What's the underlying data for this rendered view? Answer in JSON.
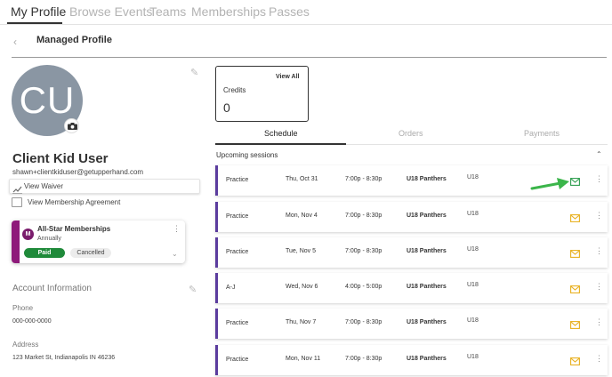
{
  "top_tabs": {
    "items": [
      {
        "label": "My Profile"
      },
      {
        "label": "Browse Events"
      },
      {
        "label": "Teams"
      },
      {
        "label": "Memberships"
      },
      {
        "label": "Passes"
      }
    ],
    "active": "My Profile"
  },
  "header": {
    "title": "Managed Profile",
    "back_icon": "chevron-left-icon"
  },
  "profile": {
    "avatar_initials": "CU",
    "name": "Client Kid User",
    "email": "shawn+clientkiduser@getupperhand.com",
    "waiver_label": "View Waiver",
    "agreement_label": "View Membership Agreement"
  },
  "membership": {
    "logo_text": "M",
    "title": "All-Star Memberships",
    "frequency": "Annually",
    "status_paid": "Paid",
    "status_cancelled": "Cancelled",
    "accent_color": "#8e1a7a"
  },
  "account": {
    "title": "Account Information",
    "phone_label": "Phone",
    "phone_value": "000-000-0000",
    "address_label": "Address",
    "address_value": "123 Market St, Indianapolis IN 46236"
  },
  "credits": {
    "label": "Credits",
    "value": "0",
    "view_all": "View All"
  },
  "schedule_tabs": {
    "items": [
      {
        "label": "Schedule"
      },
      {
        "label": "Orders"
      },
      {
        "label": "Payments"
      }
    ],
    "active": "Schedule"
  },
  "upcoming": {
    "label": "Upcoming sessions"
  },
  "sessions": [
    {
      "type": "Practice",
      "date": "Thu, Oct 31",
      "time": "7:00p  -  8:30p",
      "team": "U18 Panthers",
      "age": "U18",
      "mail_status": "sent",
      "mail_color": "#2e9e4f"
    },
    {
      "type": "Practice",
      "date": "Mon, Nov 4",
      "time": "7:00p  -  8:30p",
      "team": "U18 Panthers",
      "age": "U18",
      "mail_status": "pending",
      "mail_color": "#e8b020"
    },
    {
      "type": "Practice",
      "date": "Tue, Nov 5",
      "time": "7:00p  -  8:30p",
      "team": "U18 Panthers",
      "age": "U18",
      "mail_status": "pending",
      "mail_color": "#e8b020"
    },
    {
      "type": "A-J",
      "date": "Wed, Nov 6",
      "time": "4:00p  -  5:00p",
      "team": "U18 Panthers",
      "age": "U18",
      "mail_status": "pending",
      "mail_color": "#e8b020"
    },
    {
      "type": "Practice",
      "date": "Thu, Nov 7",
      "time": "7:00p  -  8:30p",
      "team": "U18 Panthers",
      "age": "U18",
      "mail_status": "pending",
      "mail_color": "#e8b020"
    },
    {
      "type": "Practice",
      "date": "Mon, Nov 11",
      "time": "7:00p  -  8:30p",
      "team": "U18 Panthers",
      "age": "U18",
      "mail_status": "pending",
      "mail_color": "#e8b020"
    }
  ],
  "colors": {
    "session_accent": "#5b3c9e",
    "arrow": "#3bb54a"
  }
}
